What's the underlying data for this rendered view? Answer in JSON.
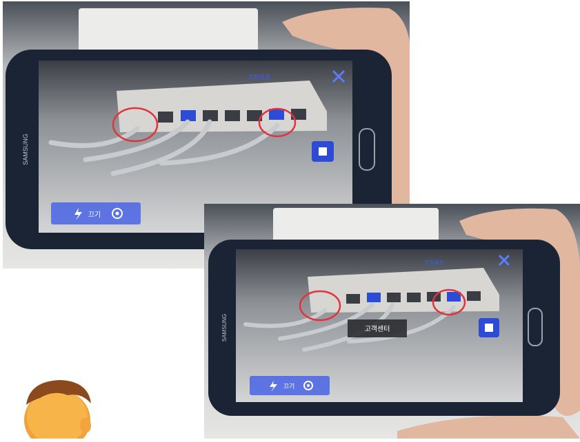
{
  "photo_top": {
    "phone_brand": "SAMSUNG",
    "app_header_text": "코치포트",
    "controls": {
      "flash_icon": "lightning-icon",
      "switch_label": "끄기",
      "settings_icon": "gear-icon"
    },
    "close_icon": "close-icon",
    "stop_icon": "stop-icon"
  },
  "photo_bottom": {
    "phone_brand": "SAMSUNG",
    "app_header_text": "코치포트",
    "toast_text": "고객센터",
    "controls": {
      "flash_icon": "lightning-icon",
      "switch_label": "끄기",
      "settings_icon": "gear-icon"
    },
    "close_icon": "close-icon",
    "stop_icon": "stop-icon"
  },
  "colors": {
    "phone_body": "#1b2434",
    "app_accent": "#2e4bd6",
    "highlight_circle": "#e0343c",
    "router_body": "#d8d6d2",
    "cable": "#c8cbcf"
  },
  "mascot": {
    "icon": "cartoon-face-icon"
  }
}
